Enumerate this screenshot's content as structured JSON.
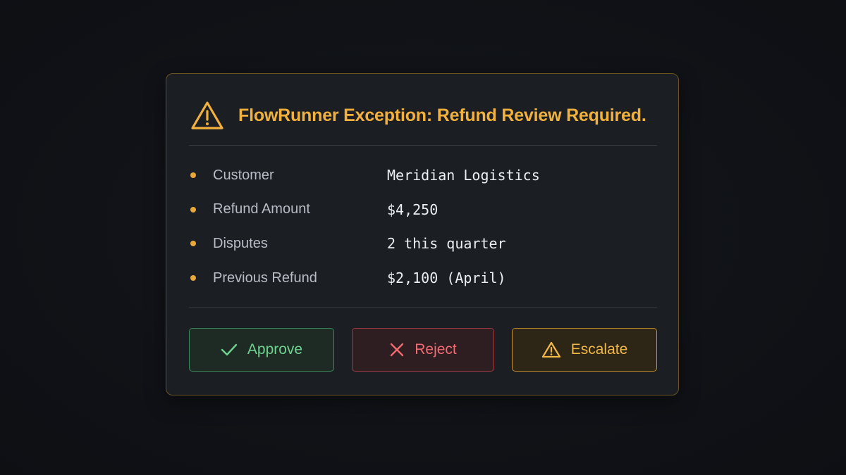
{
  "dialog": {
    "title": "FlowRunner Exception: Refund Review Required.",
    "header_icon": "warning-triangle-icon"
  },
  "details": [
    {
      "label": "Customer",
      "value": "Meridian Logistics"
    },
    {
      "label": "Refund Amount",
      "value": "$4,250"
    },
    {
      "label": "Disputes",
      "value": "2 this quarter"
    },
    {
      "label": "Previous Refund",
      "value": "$2,100 (April)"
    }
  ],
  "actions": {
    "approve": {
      "label": "Approve",
      "icon": "check-icon",
      "color": "#6fd38f"
    },
    "reject": {
      "label": "Reject",
      "icon": "close-icon",
      "color": "#f06b70"
    },
    "escalate": {
      "label": "Escalate",
      "icon": "warning-triangle-icon",
      "color": "#f2b847"
    }
  },
  "colors": {
    "accent": "#f2b13c",
    "background": "#101217",
    "card": "#1b1e23"
  }
}
